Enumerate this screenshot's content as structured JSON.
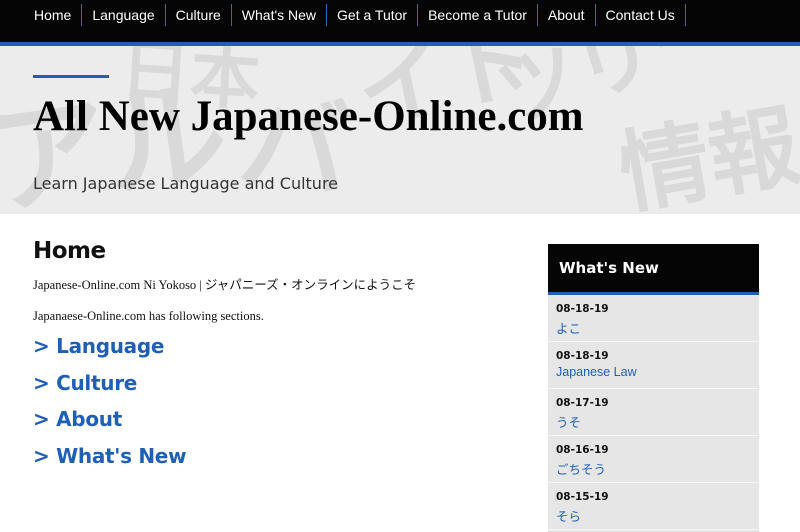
{
  "nav": {
    "items": [
      {
        "label": "Home"
      },
      {
        "label": "Language"
      },
      {
        "label": "Culture"
      },
      {
        "label": "What's New"
      },
      {
        "label": "Get a Tutor"
      },
      {
        "label": "Become a Tutor"
      },
      {
        "label": "About"
      },
      {
        "label": "Contact Us"
      }
    ]
  },
  "header": {
    "title": "All New Japanese-Online.com",
    "tagline": "Learn Japanese Language and Culture"
  },
  "main": {
    "heading": "Home",
    "intro": "Japanese-Online.com Ni Yokoso | ジャパニーズ・オンラインにようこそ",
    "sections_intro": "Japanaese-Online.com has following sections.",
    "section_links": [
      {
        "label": "> Language"
      },
      {
        "label": "> Culture"
      },
      {
        "label": "> About"
      },
      {
        "label": "> What's New"
      }
    ]
  },
  "sidebar": {
    "title": "What's New",
    "items": [
      {
        "date": "08-18-19",
        "link": "よこ"
      },
      {
        "date": "08-18-19",
        "link": "Japanese Law"
      },
      {
        "date": "08-17-19",
        "link": "うそ"
      },
      {
        "date": "08-16-19",
        "link": "ごちそう"
      },
      {
        "date": "08-15-19",
        "link": "そら"
      }
    ]
  },
  "colors": {
    "accent": "#1f5fb8",
    "nav_background": "#050505",
    "sidebar_background": "#e6e6e6"
  }
}
